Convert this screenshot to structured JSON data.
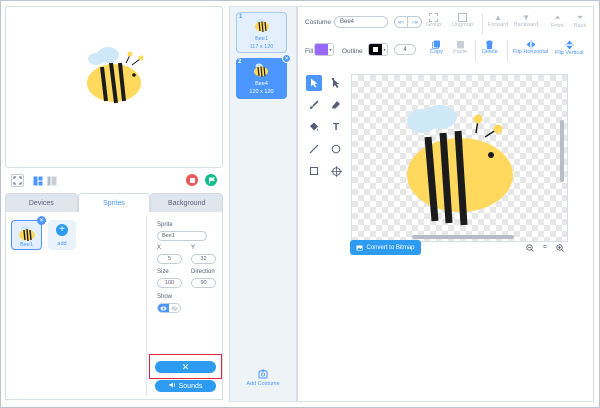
{
  "stage": {},
  "tabs": [
    {
      "label": "Devices"
    },
    {
      "label": "Sprites"
    },
    {
      "label": "Background"
    }
  ],
  "sprites": [
    {
      "label": "Bee1"
    }
  ],
  "add_sprite": {
    "label": "add"
  },
  "properties": {
    "sprite_label": "Sprite",
    "sprite_name": "Bee1",
    "x_label": "X",
    "x_value": "5",
    "y_label": "Y",
    "y_value": "32",
    "size_label": "Size",
    "size_value": "100",
    "direction_label": "Direction",
    "direction_value": "90",
    "show_label": "Show"
  },
  "delete_button": {
    "label": "✕"
  },
  "sounds_button": {
    "label": "Sounds"
  },
  "costumes": [
    {
      "index": "1",
      "name": "Bee1",
      "size": "117 x 120"
    },
    {
      "index": "2",
      "name": "Bee4",
      "size": "120 x 120"
    }
  ],
  "add_costume": {
    "label": "Add Costume"
  },
  "editor": {
    "costume_label": "Costume",
    "costume_name": "Bee4",
    "fill_label": "Fill",
    "outline_label": "Outline",
    "outline_width": "4",
    "fill_color": "#9966ff",
    "outline_color": "#000000",
    "toolbar": [
      {
        "label": "Group",
        "icon": "group-icon"
      },
      {
        "label": "Ungroup",
        "icon": "ungroup-icon"
      },
      {
        "label": "Forward",
        "icon": "forward-icon"
      },
      {
        "label": "Backward",
        "icon": "backward-icon"
      },
      {
        "label": "Front",
        "icon": "front-icon"
      },
      {
        "label": "Back",
        "icon": "back-icon"
      },
      {
        "label": "Copy",
        "icon": "copy-icon"
      },
      {
        "label": "Paste",
        "icon": "paste-icon"
      },
      {
        "label": "Delete",
        "icon": "delete-icon"
      },
      {
        "label": "Flip Horizontal",
        "icon": "flip-horizontal-icon"
      },
      {
        "label": "Flip Vertical",
        "icon": "flip-vertical-icon"
      }
    ],
    "convert_button": "Convert to Bitmap",
    "zoom_reset": "="
  },
  "colors": {
    "accent": "#4c97ff",
    "stop": "#ec5959",
    "go": "#0fbd8c",
    "highlight_box": "#e0263a",
    "bee_yellow": "#ffd95e",
    "bee_wing": "#cfe8f7"
  }
}
